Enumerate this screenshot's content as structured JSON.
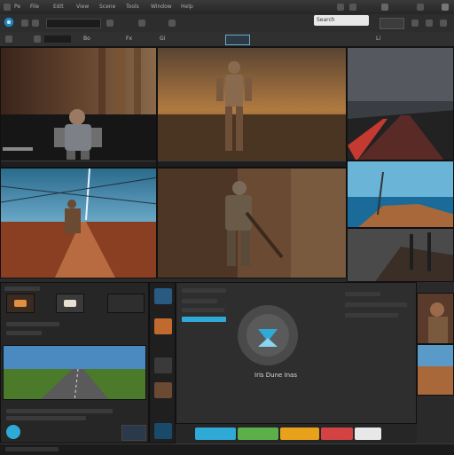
{
  "menubar": {
    "items": [
      "Pe",
      "File",
      "Edit",
      "View",
      "Scene",
      "Tools",
      "Window",
      "Help"
    ]
  },
  "toolbar": {
    "search_placeholder": "Search",
    "labels": [
      "Bo",
      "Fx",
      "Gi",
      "Li"
    ]
  },
  "center_panel": {
    "brand_text": "Iris Dune Inas"
  },
  "tags": [
    {
      "label": "",
      "color": "#2fa9d6"
    },
    {
      "label": "",
      "color": "#5bb04a"
    },
    {
      "label": "",
      "color": "#e8a11b"
    },
    {
      "label": "",
      "color": "#d44343"
    },
    {
      "label": "",
      "color": "#e8e8e8"
    }
  ],
  "icons": [
    "app-logo-icon",
    "play-icon",
    "gear-icon",
    "close-icon",
    "search-icon",
    "camera-icon"
  ],
  "colors": {
    "accent": "#2fa9d6",
    "panel_bg": "#2a2a2a",
    "dark_bar": "#1e1e1e"
  }
}
